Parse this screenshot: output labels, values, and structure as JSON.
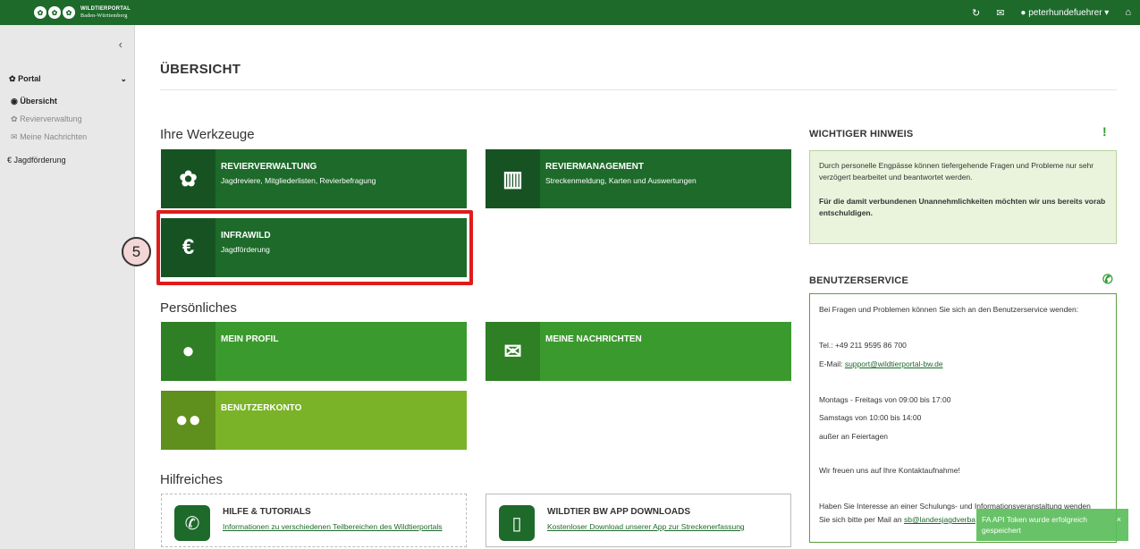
{
  "topbar": {
    "logo_line1": "WILDTIERPORTAL",
    "logo_line2": "Baden-Württemberg",
    "user_label": "peterhundefuehrer"
  },
  "sidebar": {
    "portal_label": "Portal",
    "items": [
      {
        "label": "Übersicht"
      },
      {
        "label": "Revierverwaltung"
      },
      {
        "label": "Meine Nachrichten"
      },
      {
        "label": "Jagdförderung"
      }
    ]
  },
  "main": {
    "title": "ÜBERSICHT",
    "sections": {
      "werkzeuge": "Ihre Werkzeuge",
      "persoenliches": "Persönliches",
      "hilfreiches": "Hilfreiches"
    },
    "tiles": {
      "revierverwaltung": {
        "title": "REVIERVERWALTUNG",
        "subtitle": "Jagdreviere, Mitgliederlisten, Revierbefragung"
      },
      "reviermanagement": {
        "title": "REVIERMANAGEMENT",
        "subtitle": "Streckenmeldung, Karten und Auswertungen"
      },
      "infrawild": {
        "title": "INFRAWILD",
        "subtitle": "Jagdförderung"
      },
      "mein_profil": {
        "title": "MEIN PROFIL"
      },
      "meine_nachrichten": {
        "title": "MEINE NACHRICHTEN"
      },
      "benutzerkonto": {
        "title": "BENUTZERKONTO"
      }
    },
    "help": {
      "tutorials": {
        "title": "HILFE & TUTORIALS",
        "link": "Informationen zu verschiedenen Teilbereichen des Wildtierportals"
      },
      "app": {
        "title": "WILDTIER BW APP DOWNLOADS",
        "link": "Kostenloser Download unserer App zur Streckenerfassung"
      }
    },
    "step_number": "5"
  },
  "notice": {
    "heading": "WICHTIGER HINWEIS",
    "text": "Durch personelle Engpässe können tiefergehende Fragen und Probleme nur sehr verzögert bearbeitet und beantwortet werden.",
    "bold_text": "Für die damit verbundenen Unannehmlichkeiten möchten wir uns bereits vorab entschuldigen."
  },
  "service": {
    "heading": "BENUTZERSERVICE",
    "intro": "Bei Fragen und Problemen können Sie sich an den Benutzerservice wenden:",
    "tel": "Tel.: +49 211 9595 86 700",
    "email_prefix": "E-Mail: ",
    "email": "support@wildtierportal-bw.de",
    "hours1": "Montags - Freitags von 09:00 bis 17:00",
    "hours2": "Samstags von 10:00 bis 14:00",
    "hours3": "außer an Feiertagen",
    "closing": "Wir freuen uns auf Ihre Kontaktaufnahme!",
    "training1": "Haben Sie Interesse an einer Schulungs- und Informationsveranstaltung wenden",
    "training2_prefix": "Sie sich bitte per Mail an ",
    "training_email": "sb@landesjagdverba"
  },
  "toast": {
    "text": "FA API Token wurde erfolgreich gespeichert",
    "close": "×"
  },
  "colors": {
    "brand": "#1d6a2a",
    "mid_green": "#3b9a2e",
    "lime": "#7ab327",
    "highlight": "#e01b1b"
  }
}
